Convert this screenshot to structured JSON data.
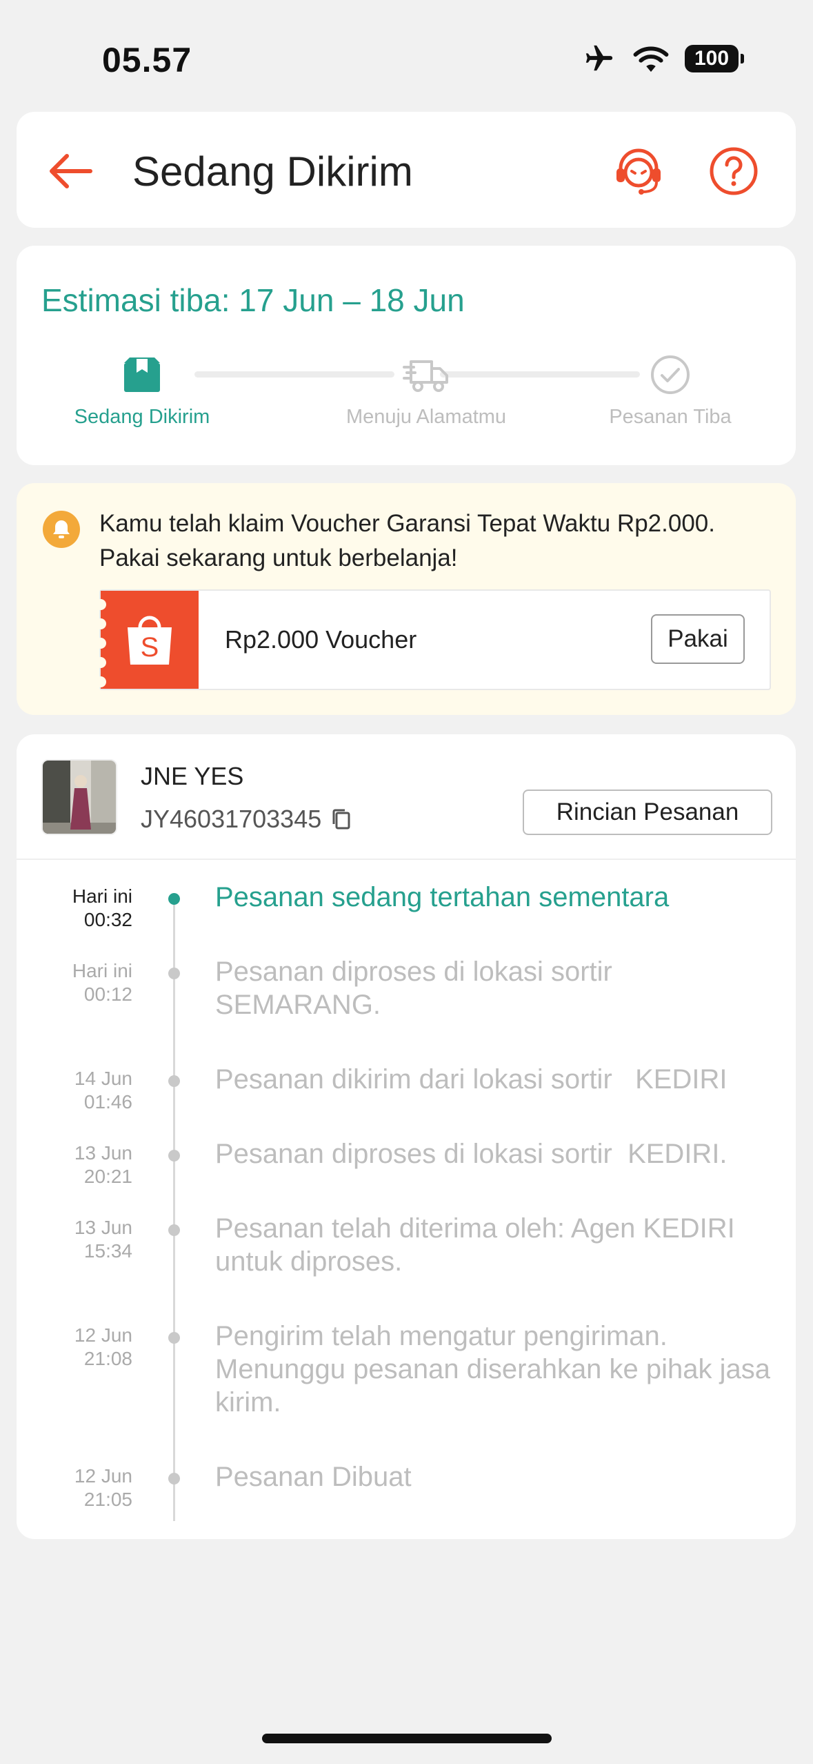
{
  "status_bar": {
    "time": "05.57",
    "battery": "100"
  },
  "header": {
    "title": "Sedang Dikirim"
  },
  "estimate": {
    "title": "Estimasi tiba: 17 Jun – 18 Jun",
    "steps": [
      {
        "label": "Sedang Dikirim",
        "state": "active"
      },
      {
        "label": "Menuju Alamatmu",
        "state": "pending"
      },
      {
        "label": "Pesanan Tiba",
        "state": "pending"
      }
    ]
  },
  "voucher": {
    "message": "Kamu telah klaim Voucher Garansi Tepat Waktu Rp2.000. Pakai sekarang untuk berbelanja!",
    "name": "Rp2.000 Voucher",
    "use_label": "Pakai",
    "brand_letter": "S"
  },
  "shipment": {
    "courier": "JNE YES",
    "tracking_number": "JY46031703345",
    "detail_label": "Rincian Pesanan"
  },
  "events": [
    {
      "date": "Hari ini",
      "time": "00:32",
      "text": "Pesanan sedang tertahan sementara",
      "active": true
    },
    {
      "date": "Hari ini",
      "time": "00:12",
      "text": "Pesanan diproses di lokasi sortir SEMARANG."
    },
    {
      "date": "14 Jun",
      "time": "01:46",
      "text": "Pesanan dikirim dari lokasi sortir   KEDIRI"
    },
    {
      "date": "13 Jun",
      "time": "20:21",
      "text": "Pesanan diproses di lokasi sortir  KEDIRI."
    },
    {
      "date": "13 Jun",
      "time": "15:34",
      "text": "Pesanan telah diterima oleh: Agen KEDIRI untuk diproses."
    },
    {
      "date": "12 Jun",
      "time": "21:08",
      "text": "Pengirim telah mengatur pengiriman. Menunggu pesanan diserahkan ke pihak jasa kirim."
    },
    {
      "date": "12 Jun",
      "time": "21:05",
      "text": "Pesanan Dibuat"
    }
  ],
  "colors": {
    "accent": "#ee4d2d",
    "teal": "#26a08e",
    "voucher_bg": "#fffbeb",
    "bell": "#f3a93a"
  },
  "icons": [
    "airplane-icon",
    "wifi-icon",
    "battery-icon",
    "back-arrow-icon",
    "customer-service-icon",
    "help-icon",
    "package-icon",
    "truck-icon",
    "check-circle-icon",
    "bell-icon",
    "shopee-bag-icon",
    "copy-icon"
  ]
}
